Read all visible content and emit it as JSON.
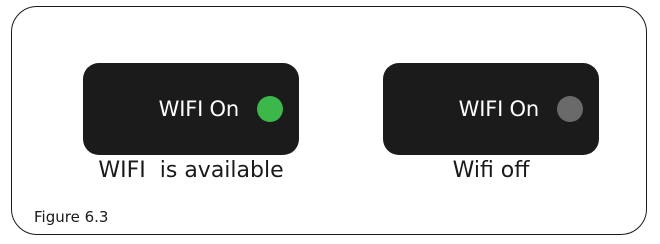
{
  "indicators": [
    {
      "label": "WIFI On",
      "led_state": "on",
      "led_color": "#3cb84a",
      "caption": "WIFI  is available"
    },
    {
      "label": "WIFI On",
      "led_state": "off",
      "led_color": "#6a6a6a",
      "caption": "Wifi off"
    }
  ],
  "figure_label": "Figure 6.3",
  "colors": {
    "panel_background": "#1b1b1b",
    "panel_text": "#ffffff",
    "frame_border": "#1a1a1a"
  }
}
